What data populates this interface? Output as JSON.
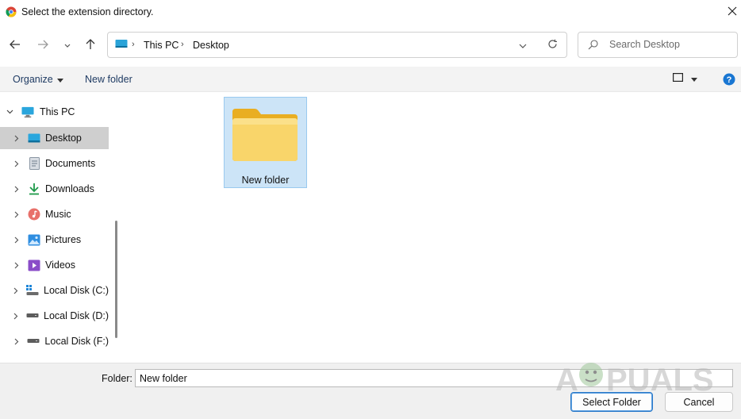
{
  "window": {
    "title": "Select the extension directory.",
    "app_icon": "chrome-icon",
    "close_icon": "close-icon"
  },
  "nav": {
    "back_icon": "arrow-left-icon",
    "forward_icon": "arrow-right-icon",
    "recent_icon": "chevron-down-icon",
    "up_icon": "arrow-up-icon",
    "breadcrumbs": [
      "This PC",
      "Desktop"
    ],
    "address_dropdown_icon": "chevron-down-icon",
    "refresh_icon": "refresh-icon",
    "search_placeholder": "Search Desktop"
  },
  "command_bar": {
    "organize": "Organize",
    "new_folder": "New folder",
    "view_icon": "view-pane-icon",
    "help_icon": "help-icon"
  },
  "sidebar": {
    "root": "This PC",
    "items": [
      {
        "label": "Desktop",
        "icon": "desktop-icon",
        "selected": true
      },
      {
        "label": "Documents",
        "icon": "documents-icon"
      },
      {
        "label": "Downloads",
        "icon": "downloads-icon"
      },
      {
        "label": "Music",
        "icon": "music-icon"
      },
      {
        "label": "Pictures",
        "icon": "pictures-icon"
      },
      {
        "label": "Videos",
        "icon": "videos-icon"
      },
      {
        "label": "Local Disk (C:)",
        "icon": "drive-icon"
      },
      {
        "label": "Local Disk (D:)",
        "icon": "drive-icon"
      },
      {
        "label": "Local Disk (F:)",
        "icon": "drive-icon"
      }
    ]
  },
  "content": {
    "items": [
      {
        "label": "New folder",
        "icon": "folder-icon",
        "selected": true
      }
    ]
  },
  "footer": {
    "folder_label": "Folder:",
    "folder_value": "New folder",
    "select_button": "Select Folder",
    "cancel_button": "Cancel"
  },
  "watermark": {
    "text": "APPUALS"
  },
  "colors": {
    "selection_bg": "#cce4f7",
    "selection_border": "#99c9ef",
    "tree_selected": "#cfcfcf",
    "folder_yellow": "#f8c746",
    "help_blue": "#1976d2"
  }
}
